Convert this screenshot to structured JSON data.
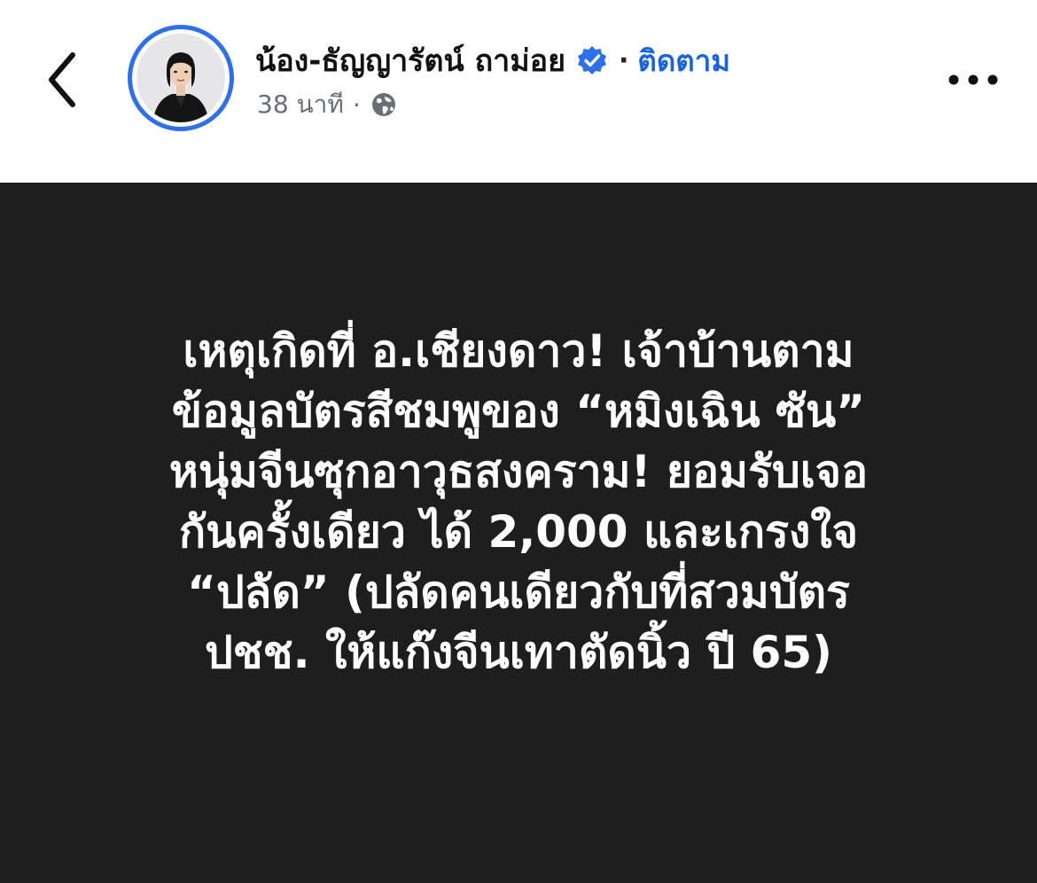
{
  "header": {
    "author_name": "น้อง-ธัญญารัตน์ ถาม่อย",
    "verified_icon": "verified-badge-icon",
    "separator": "·",
    "follow_label": "ติดตาม",
    "timestamp": "38 นาที",
    "meta_separator": "·",
    "privacy_icon": "globe-icon",
    "back_icon": "chevron-left-icon",
    "more_icon": "more-horizontal-icon",
    "avatar_icon": "profile-photo"
  },
  "post": {
    "lines": [
      "เหตุเกิดที่ อ.เชียงดาว! เจ้าบ้านตาม",
      "ข้อมูลบัตรสีชมพูของ “หมิงเฉิน ซัน”",
      "หนุ่มจีนซุกอาวุธสงคราม! ยอมรับเจอ",
      "กันครั้งเดียว ได้ 2,000 และเกรงใจ",
      "“ปลัด” (ปลัดคนเดียวกับที่สวมบัตร",
      "ปชช. ให้แก๊งจีนเทาตัดนิ้ว ปี 65)"
    ],
    "background_color": "#1e1e1e",
    "text_color": "#ffffff"
  },
  "colors": {
    "accent": "#1b64d6",
    "avatar_ring": "#2f6fe8",
    "meta_text": "#6b6e74"
  }
}
